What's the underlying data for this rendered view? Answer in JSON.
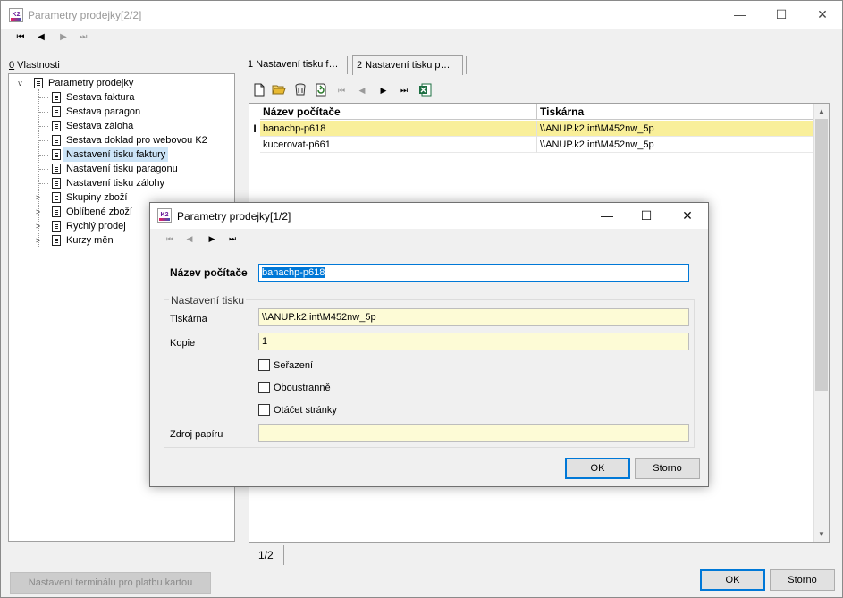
{
  "main_window": {
    "title": "Parametry prodejky[2/2]",
    "icon_label": "K2",
    "controls": {
      "minimize": "—",
      "maximize": "☐",
      "close": "✕"
    },
    "nav": {
      "first": "⏮",
      "prev": "◀",
      "next": "▶",
      "last": "⏭"
    }
  },
  "left_panel": {
    "caption_key": "0",
    "caption_rest": " Vlastnosti",
    "tree": [
      {
        "label": "Parametry prodejky",
        "expander": "v"
      },
      {
        "label": "Sestava faktura"
      },
      {
        "label": "Sestava paragon"
      },
      {
        "label": "Sestava záloha"
      },
      {
        "label": "Sestava doklad pro webovou K2"
      },
      {
        "label": "Nastavení tisku faktury",
        "selected": true
      },
      {
        "label": "Nastavení tisku paragonu"
      },
      {
        "label": "Nastavení tisku zálohy"
      },
      {
        "label": "Skupiny zboží",
        "expander": ">"
      },
      {
        "label": "Oblíbené zboží",
        "expander": ">"
      },
      {
        "label": "Rychlý prodej",
        "expander": ">"
      },
      {
        "label": "Kurzy měn",
        "expander": ">"
      }
    ]
  },
  "tabs": [
    {
      "label": "1 Nastavení tisku f…",
      "active": false
    },
    {
      "label": "2 Nastavení tisku p…",
      "active": true
    }
  ],
  "grid_toolbar": {
    "new_icon": "new-document-icon",
    "open_icon": "open-folder-icon",
    "delete_icon": "delete-icon",
    "refresh_icon": "refresh-icon",
    "excel_icon": "excel-export-icon"
  },
  "grid": {
    "columns": [
      "Název počítače",
      "Tiskárna"
    ],
    "rows": [
      {
        "name": "banachp-p618",
        "printer": "\\\\ANUP.k2.int\\M452nw_5p",
        "selected": true
      },
      {
        "name": "kucerovat-p661",
        "printer": "\\\\ANUP.k2.int\\M452nw_5p",
        "selected": false
      }
    ],
    "row_indicator": "I",
    "scroll_up": "▲",
    "scroll_down": "▼",
    "selected_color": "#f9ef9a"
  },
  "status": {
    "position": "1/2"
  },
  "bottom": {
    "terminal_button": "Nastavení terminálu pro platbu kartou",
    "ok": "OK",
    "cancel": "Storno"
  },
  "dialog": {
    "title": "Parametry prodejky[1/2]",
    "icon_label": "K2",
    "controls": {
      "minimize": "—",
      "maximize": "☐",
      "close": "✕"
    },
    "nav": {
      "first": "⏮",
      "prev": "◀",
      "next": "▶",
      "last": "⏭"
    },
    "computer_name_label": "Název počítače",
    "computer_name_value": "banachp-p618",
    "group_title": "Nastavení tisku",
    "printer_label": "Tiskárna",
    "printer_value": "\\\\ANUP.k2.int\\M452nw_5p",
    "copies_label": "Kopie",
    "copies_value": "1",
    "sort_label": "Seřazení",
    "duplex_label": "Oboustranně",
    "flip_label": "Otáčet stránky",
    "paper_source_label": "Zdroj papíru",
    "paper_source_value": "",
    "ok": "OK",
    "cancel": "Storno",
    "accent_color": "#0078d7"
  }
}
